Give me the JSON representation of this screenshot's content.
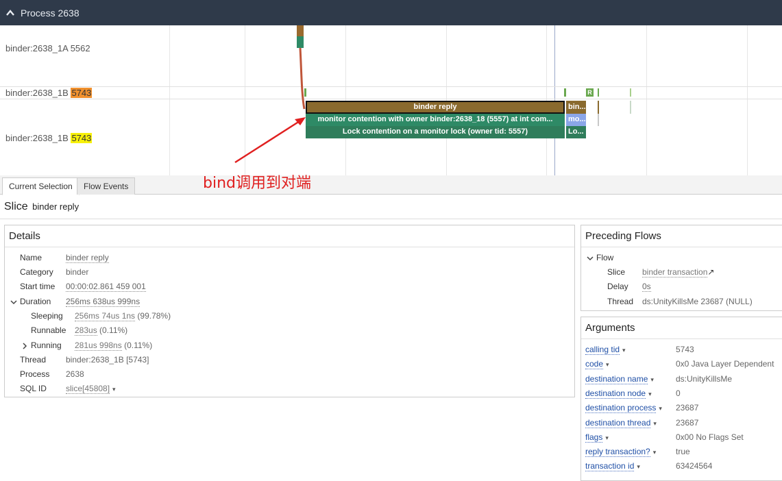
{
  "header": {
    "title": "Process 2638"
  },
  "tracks": {
    "rows": [
      {
        "label": "binder:2638_1A 5562",
        "tid_badge": ""
      },
      {
        "label": "binder:2638_1B",
        "tid_badge": "5743"
      },
      {
        "label": "binder:2638_1B",
        "tid_badge": "5743"
      }
    ],
    "slices": {
      "binder_reply": "binder reply",
      "binder_reply_short": "bin...",
      "monitor": "monitor contention with owner binder:2638_18 (5557) at int com...",
      "monitor_short": "mo...",
      "lock": "Lock contention on a monitor lock (owner tid: 5557)",
      "lock_short": "Lo...",
      "r_marker": "R"
    },
    "annotation": "bind调用到对端"
  },
  "tabs": [
    "Current Selection",
    "Flow Events"
  ],
  "selection": {
    "kind": "Slice",
    "name": "binder reply"
  },
  "details": {
    "title": "Details",
    "name_label": "Name",
    "name_value": "binder reply",
    "category_label": "Category",
    "category_value": "binder",
    "start_label": "Start time",
    "start_value": "00:00:02.861 459 001",
    "duration_label": "Duration",
    "duration_value": "256ms 638us 999ns",
    "sleeping_label": "Sleeping",
    "sleeping_value": "256ms 74us 1ns",
    "sleeping_pct": "(99.78%)",
    "runnable_label": "Runnable",
    "runnable_value": "283us",
    "runnable_pct": "(0.11%)",
    "running_label": "Running",
    "running_value": "281us 998ns",
    "running_pct": "(0.11%)",
    "thread_label": "Thread",
    "thread_value": "binder:2638_1B [5743]",
    "process_label": "Process",
    "process_value": "2638",
    "sqlid_label": "SQL ID",
    "sqlid_value": "slice[45808]"
  },
  "preceding_flows": {
    "title": "Preceding Flows",
    "flow_label": "Flow",
    "slice_label": "Slice",
    "slice_value": "binder transaction",
    "delay_label": "Delay",
    "delay_value": "0s",
    "thread_label": "Thread",
    "thread_value": "ds:UnityKillsMe 23687 (NULL)"
  },
  "arguments": {
    "title": "Arguments",
    "items": [
      {
        "key": "calling tid",
        "value": "5743"
      },
      {
        "key": "code",
        "value": "0x0 Java Layer Dependent"
      },
      {
        "key": "destination name",
        "value": "ds:UnityKillsMe"
      },
      {
        "key": "destination node",
        "value": "0"
      },
      {
        "key": "destination process",
        "value": "23687"
      },
      {
        "key": "destination thread",
        "value": "23687"
      },
      {
        "key": "flags",
        "value": "0x00 No Flags Set"
      },
      {
        "key": "reply transaction?",
        "value": "true"
      },
      {
        "key": "transaction id",
        "value": "63424564"
      }
    ]
  },
  "colors": {
    "header_bg": "#2f3a4a",
    "binder_reply": "#8a6a2e",
    "monitor": "#2e8a66",
    "lock": "#2f7d5b",
    "annotation": "#e02020"
  }
}
